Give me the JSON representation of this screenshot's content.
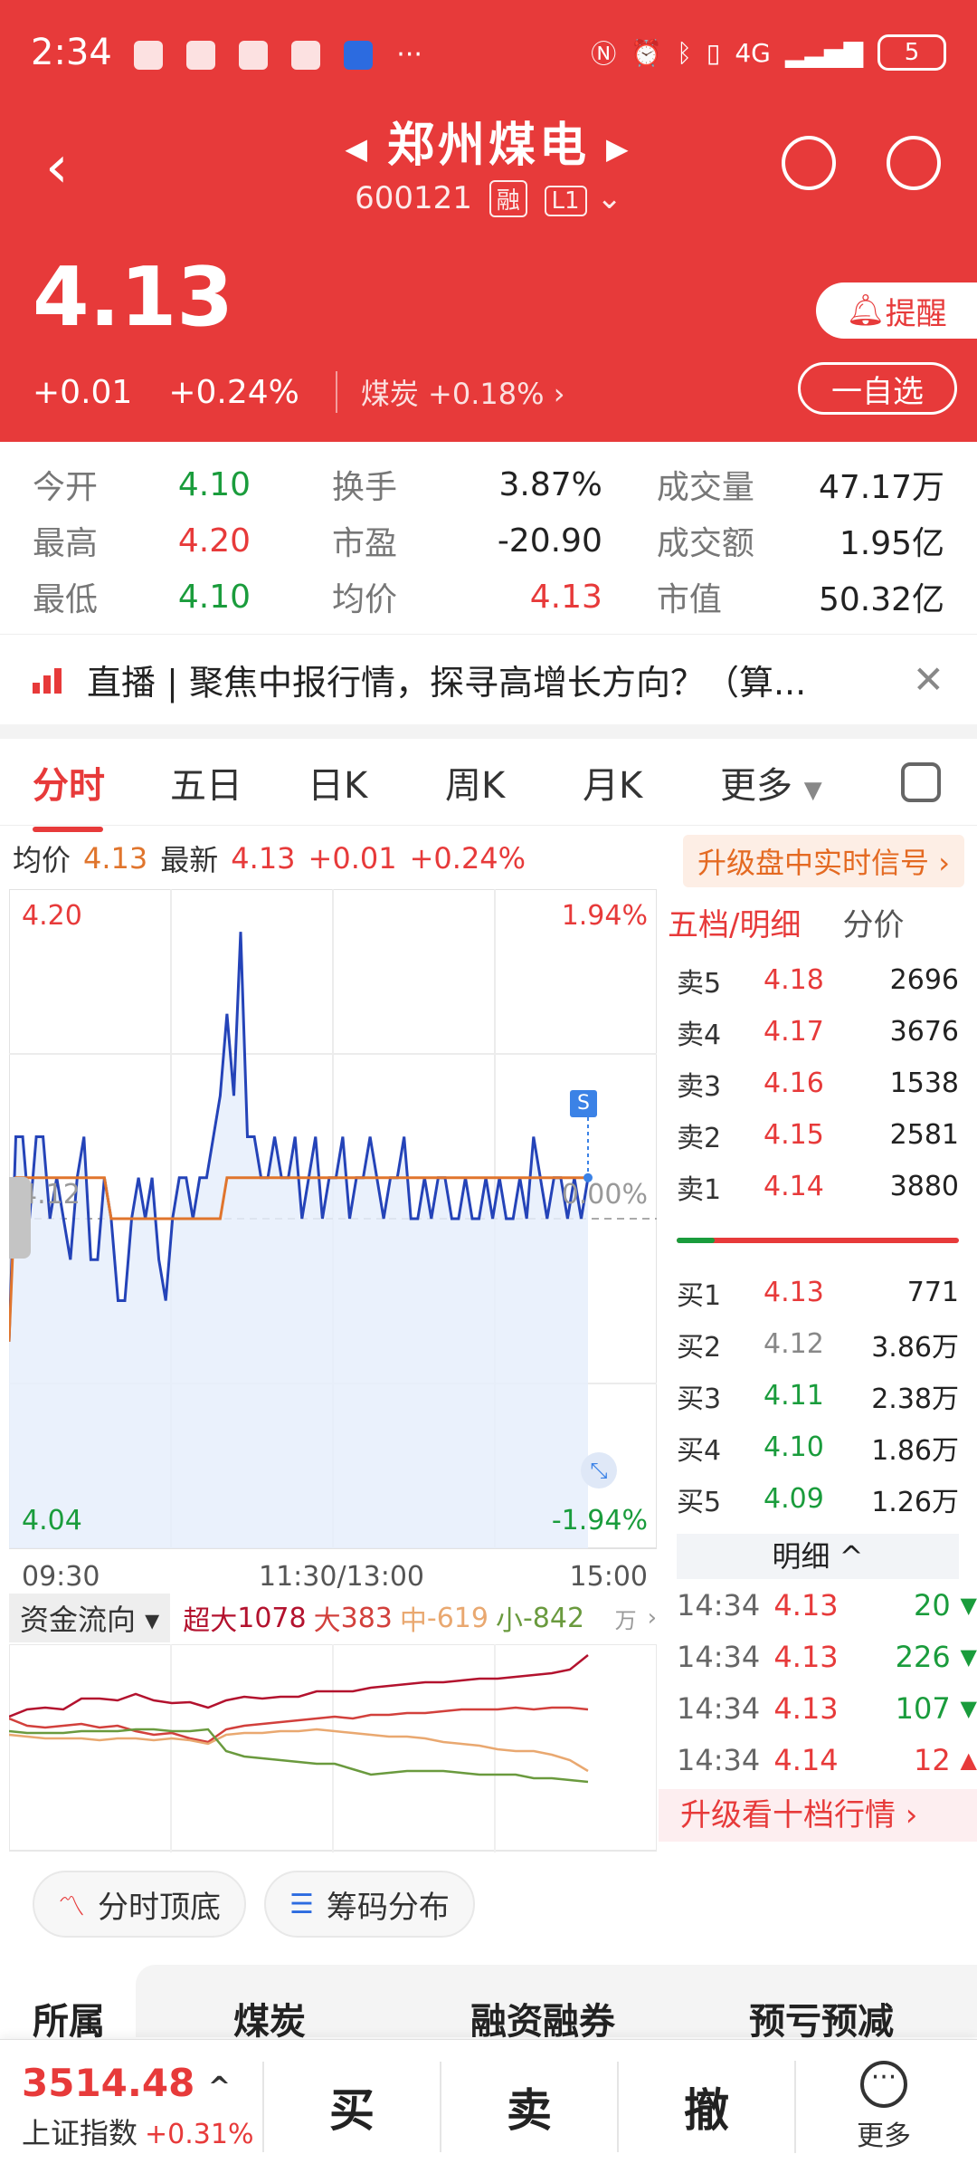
{
  "status_bar": {
    "time": "2:34",
    "network": "4G",
    "battery": "5",
    "more_notifications": "···"
  },
  "header": {
    "stock_name": "郑州煤电",
    "prev_arrow": "◀",
    "next_arrow": "▶",
    "code": "600121",
    "tag_margin": "融",
    "tag_level": "L1",
    "price": "4.13",
    "change": "+0.01",
    "change_pct": "+0.24%",
    "sector_name": "煤炭",
    "sector_change": "+0.18%",
    "remind_label": "提醒",
    "watch_label": "一自选"
  },
  "stats": {
    "open_label": "今开",
    "open": "4.10",
    "high_label": "最高",
    "high": "4.20",
    "low_label": "最低",
    "low": "4.10",
    "turnover_label": "换手",
    "turnover": "3.87%",
    "pe_label": "市盈",
    "pe": "-20.90",
    "avg_label": "均价",
    "avg": "4.13",
    "volume_label": "成交量",
    "volume": "47.17万",
    "amount_label": "成交额",
    "amount": "1.95亿",
    "mktcap_label": "市值",
    "mktcap": "50.32亿"
  },
  "live": {
    "text": "直播 | 聚焦中报行情，探寻高增长方向？（算...",
    "close": "✕"
  },
  "tabs": [
    "分时",
    "五日",
    "日K",
    "周K",
    "月K",
    "更多"
  ],
  "info_line": {
    "avg_label": "均价",
    "avg": "4.13",
    "latest_label": "最新",
    "latest": "4.13",
    "change": "+0.01",
    "change_pct": "+0.24%",
    "upgrade": "升级盘中实时信号 ›"
  },
  "chart_data": {
    "type": "line",
    "x_ticks": [
      "09:30",
      "11:30/13:00",
      "15:00"
    ],
    "y_left": [
      "4.20",
      "4.12",
      "4.04"
    ],
    "y_right": [
      "1.94%",
      "0.00%",
      "-1.94%"
    ],
    "ylim": [
      4.04,
      4.2
    ],
    "baseline": 4.12,
    "series": [
      {
        "color": "#2443b8",
        "values": [
          4.09,
          4.14,
          4.14,
          4.12,
          4.14,
          4.14,
          4.12,
          4.13,
          4.12,
          4.11,
          4.13,
          4.14,
          4.11,
          4.11,
          4.13,
          4.12,
          4.1,
          4.1,
          4.12,
          4.13,
          4.12,
          4.13,
          4.11,
          4.1,
          4.12,
          4.13,
          4.13,
          4.12,
          4.13,
          4.13,
          4.14,
          4.15,
          4.17,
          4.15,
          4.19,
          4.14,
          4.14,
          4.13,
          4.13,
          4.14,
          4.13,
          4.13,
          4.14,
          4.12,
          4.13,
          4.14,
          4.12,
          4.13,
          4.13,
          4.14,
          4.12,
          4.13,
          4.13,
          4.14,
          4.13,
          4.12,
          4.13,
          4.13,
          4.14,
          4.12,
          4.12,
          4.13,
          4.12,
          4.13,
          4.13,
          4.12,
          4.12,
          4.13,
          4.12,
          4.12,
          4.13,
          4.12,
          4.13,
          4.12,
          4.12,
          4.13,
          4.12,
          4.14,
          4.13,
          4.12,
          4.13,
          4.13,
          4.12,
          4.13,
          4.12,
          4.13
        ]
      },
      {
        "color": "#e0752d",
        "values": [
          4.09,
          4.13,
          4.13,
          4.13,
          4.13,
          4.13,
          4.13,
          4.13,
          4.13,
          4.13,
          4.13,
          4.13,
          4.13,
          4.13,
          4.13,
          4.12,
          4.12,
          4.12,
          4.12,
          4.12,
          4.12,
          4.12,
          4.12,
          4.12,
          4.12,
          4.12,
          4.12,
          4.12,
          4.12,
          4.12,
          4.12,
          4.12,
          4.13,
          4.13,
          4.13,
          4.13,
          4.13,
          4.13,
          4.13,
          4.13,
          4.13,
          4.13,
          4.13,
          4.13,
          4.13,
          4.13,
          4.13,
          4.13,
          4.13,
          4.13,
          4.13,
          4.13,
          4.13,
          4.13,
          4.13,
          4.13,
          4.13,
          4.13,
          4.13,
          4.13,
          4.13,
          4.13,
          4.13,
          4.13,
          4.13,
          4.13,
          4.13,
          4.13,
          4.13,
          4.13,
          4.13,
          4.13,
          4.13,
          4.13,
          4.13,
          4.13,
          4.13,
          4.13,
          4.13,
          4.13,
          4.13,
          4.13,
          4.13,
          4.13,
          4.13,
          4.13
        ]
      }
    ]
  },
  "flow": {
    "selector": "资金流向 ▾",
    "super_label": "超大",
    "super": "1078",
    "big_label": "大",
    "big": "383",
    "mid_label": "中",
    "mid": "-619",
    "small_label": "小",
    "small": "-842",
    "unit": "万",
    "colors": {
      "super": "#b3122e",
      "big": "#d2403c",
      "mid": "#e9a870",
      "small": "#6a9a3e"
    }
  },
  "order_book": {
    "title": "五档/明细",
    "tab2": "分价",
    "asks": [
      {
        "level": "卖5",
        "price": "4.18",
        "vol": "2696"
      },
      {
        "level": "卖4",
        "price": "4.17",
        "vol": "3676"
      },
      {
        "level": "卖3",
        "price": "4.16",
        "vol": "1538"
      },
      {
        "level": "卖2",
        "price": "4.15",
        "vol": "2581"
      },
      {
        "level": "卖1",
        "price": "4.14",
        "vol": "3880"
      }
    ],
    "bids": [
      {
        "level": "买1",
        "price": "4.13",
        "vol": "771"
      },
      {
        "level": "买2",
        "price": "4.12",
        "vol": "3.86万"
      },
      {
        "level": "买3",
        "price": "4.11",
        "vol": "2.38万"
      },
      {
        "level": "买4",
        "price": "4.10",
        "vol": "1.86万"
      },
      {
        "level": "买5",
        "price": "4.09",
        "vol": "1.26万"
      }
    ],
    "detail_title": "明细 ^",
    "ticks": [
      {
        "time": "14:34",
        "price": "4.13",
        "vol": "20",
        "dir": "▼"
      },
      {
        "time": "14:34",
        "price": "4.13",
        "vol": "226",
        "dir": "▼"
      },
      {
        "time": "14:34",
        "price": "4.13",
        "vol": "107",
        "dir": "▼"
      },
      {
        "time": "14:34",
        "price": "4.14",
        "vol": "12",
        "dir": "▲"
      }
    ],
    "upgrade10": "升级看十档行情 ›"
  },
  "chips": {
    "peak": "分时顶底",
    "chip": "筹码分布"
  },
  "sector_strip": [
    "所属",
    "煤炭",
    "融资融券",
    "预亏预减"
  ],
  "bottom_bar": {
    "index_value": "3514.48",
    "index_name": "上证指数",
    "index_change": "+0.31%",
    "buy": "买",
    "sell": "卖",
    "cancel": "撤",
    "more": "更多"
  }
}
